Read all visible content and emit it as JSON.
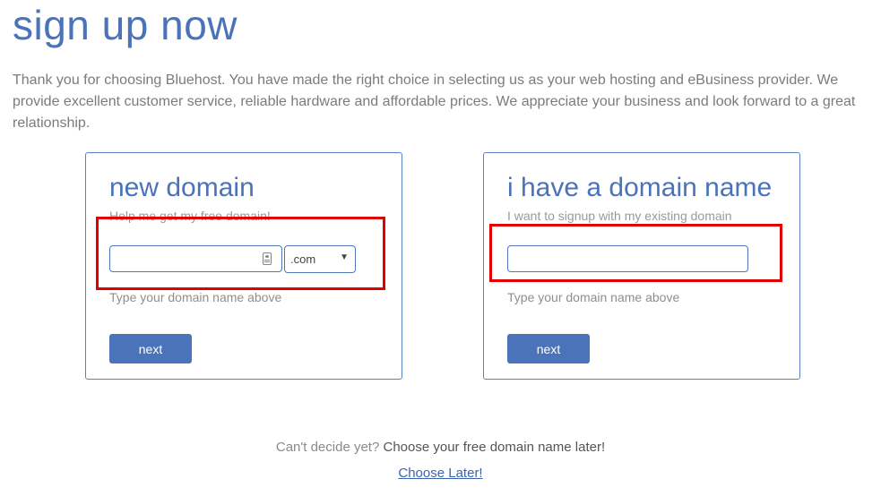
{
  "page": {
    "title": "sign up now",
    "intro": "Thank you for choosing Bluehost. You have made the right choice in selecting us as your web hosting and eBusiness provider. We provide excellent customer service, reliable hardware and affordable prices. We appreciate your business and look forward to a great relationship."
  },
  "new_domain": {
    "title": "new domain",
    "subtitle": "Help me get my free domain!",
    "input_value": "",
    "tld_selected": ".com",
    "hint": "Type your domain name above",
    "next_label": "next"
  },
  "existing_domain": {
    "title": "i have a domain name",
    "subtitle": "I want to signup with my existing domain",
    "input_value": "",
    "hint": "Type your domain name above",
    "next_label": "next"
  },
  "footer": {
    "question": "Can't decide yet?",
    "prompt": "Choose your free domain name later!",
    "link_label": "Choose Later!"
  },
  "icons": {
    "field_icon": "contact-card-icon",
    "select_arrow": "dropdown-arrow-icon"
  },
  "colors": {
    "accent": "#4a73b9",
    "highlight": "#e00000",
    "text_muted": "#7b7b7b"
  }
}
